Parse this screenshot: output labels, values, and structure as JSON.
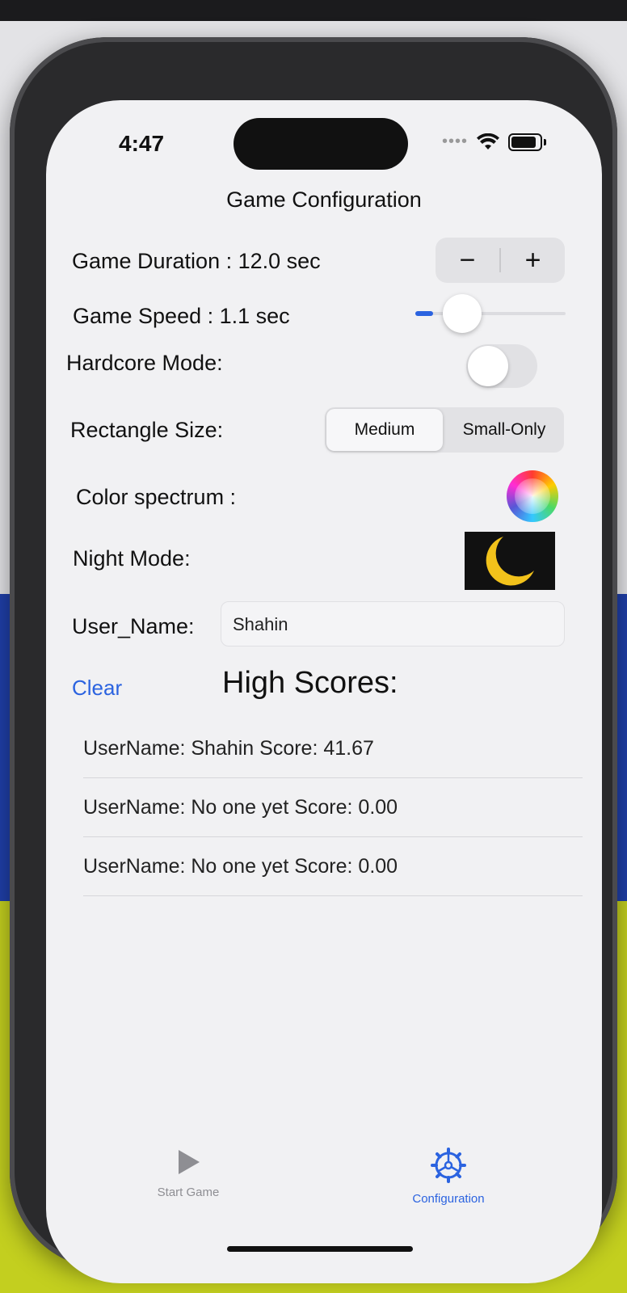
{
  "status_bar": {
    "time": "4:47",
    "dots": "••••"
  },
  "page": {
    "title": "Game Configuration"
  },
  "settings": {
    "duration_label": "Game Duration : 12.0 sec",
    "stepper_minus": "−",
    "stepper_plus": "+",
    "speed_label": "Game Speed :  1.1 sec",
    "speed_slider_fraction": 0.12,
    "hardcore_label": "Hardcore Mode:",
    "hardcore_on": false,
    "rect_size_label": "Rectangle Size:",
    "rect_size_options": [
      "Medium",
      "Small-Only"
    ],
    "rect_size_selected": "Medium",
    "color_label": "Color spectrum :",
    "night_label": "Night Mode:",
    "username_label": "User_Name:",
    "username_value": "Shahin"
  },
  "high_scores": {
    "clear_label": "Clear",
    "title": "High Scores:",
    "rows": [
      "UserName: Shahin Score: 41.67",
      "UserName: No one yet Score: 0.00",
      "UserName: No one yet Score: 0.00"
    ]
  },
  "tabbar": {
    "tabs": [
      {
        "label": "Start Game",
        "icon": "play-icon"
      },
      {
        "label": "Configuration",
        "icon": "gear-icon"
      }
    ],
    "active": "Configuration"
  },
  "colors": {
    "accent": "#2b63e0",
    "moon": "#f2c21b",
    "night_bg": "#111111"
  }
}
